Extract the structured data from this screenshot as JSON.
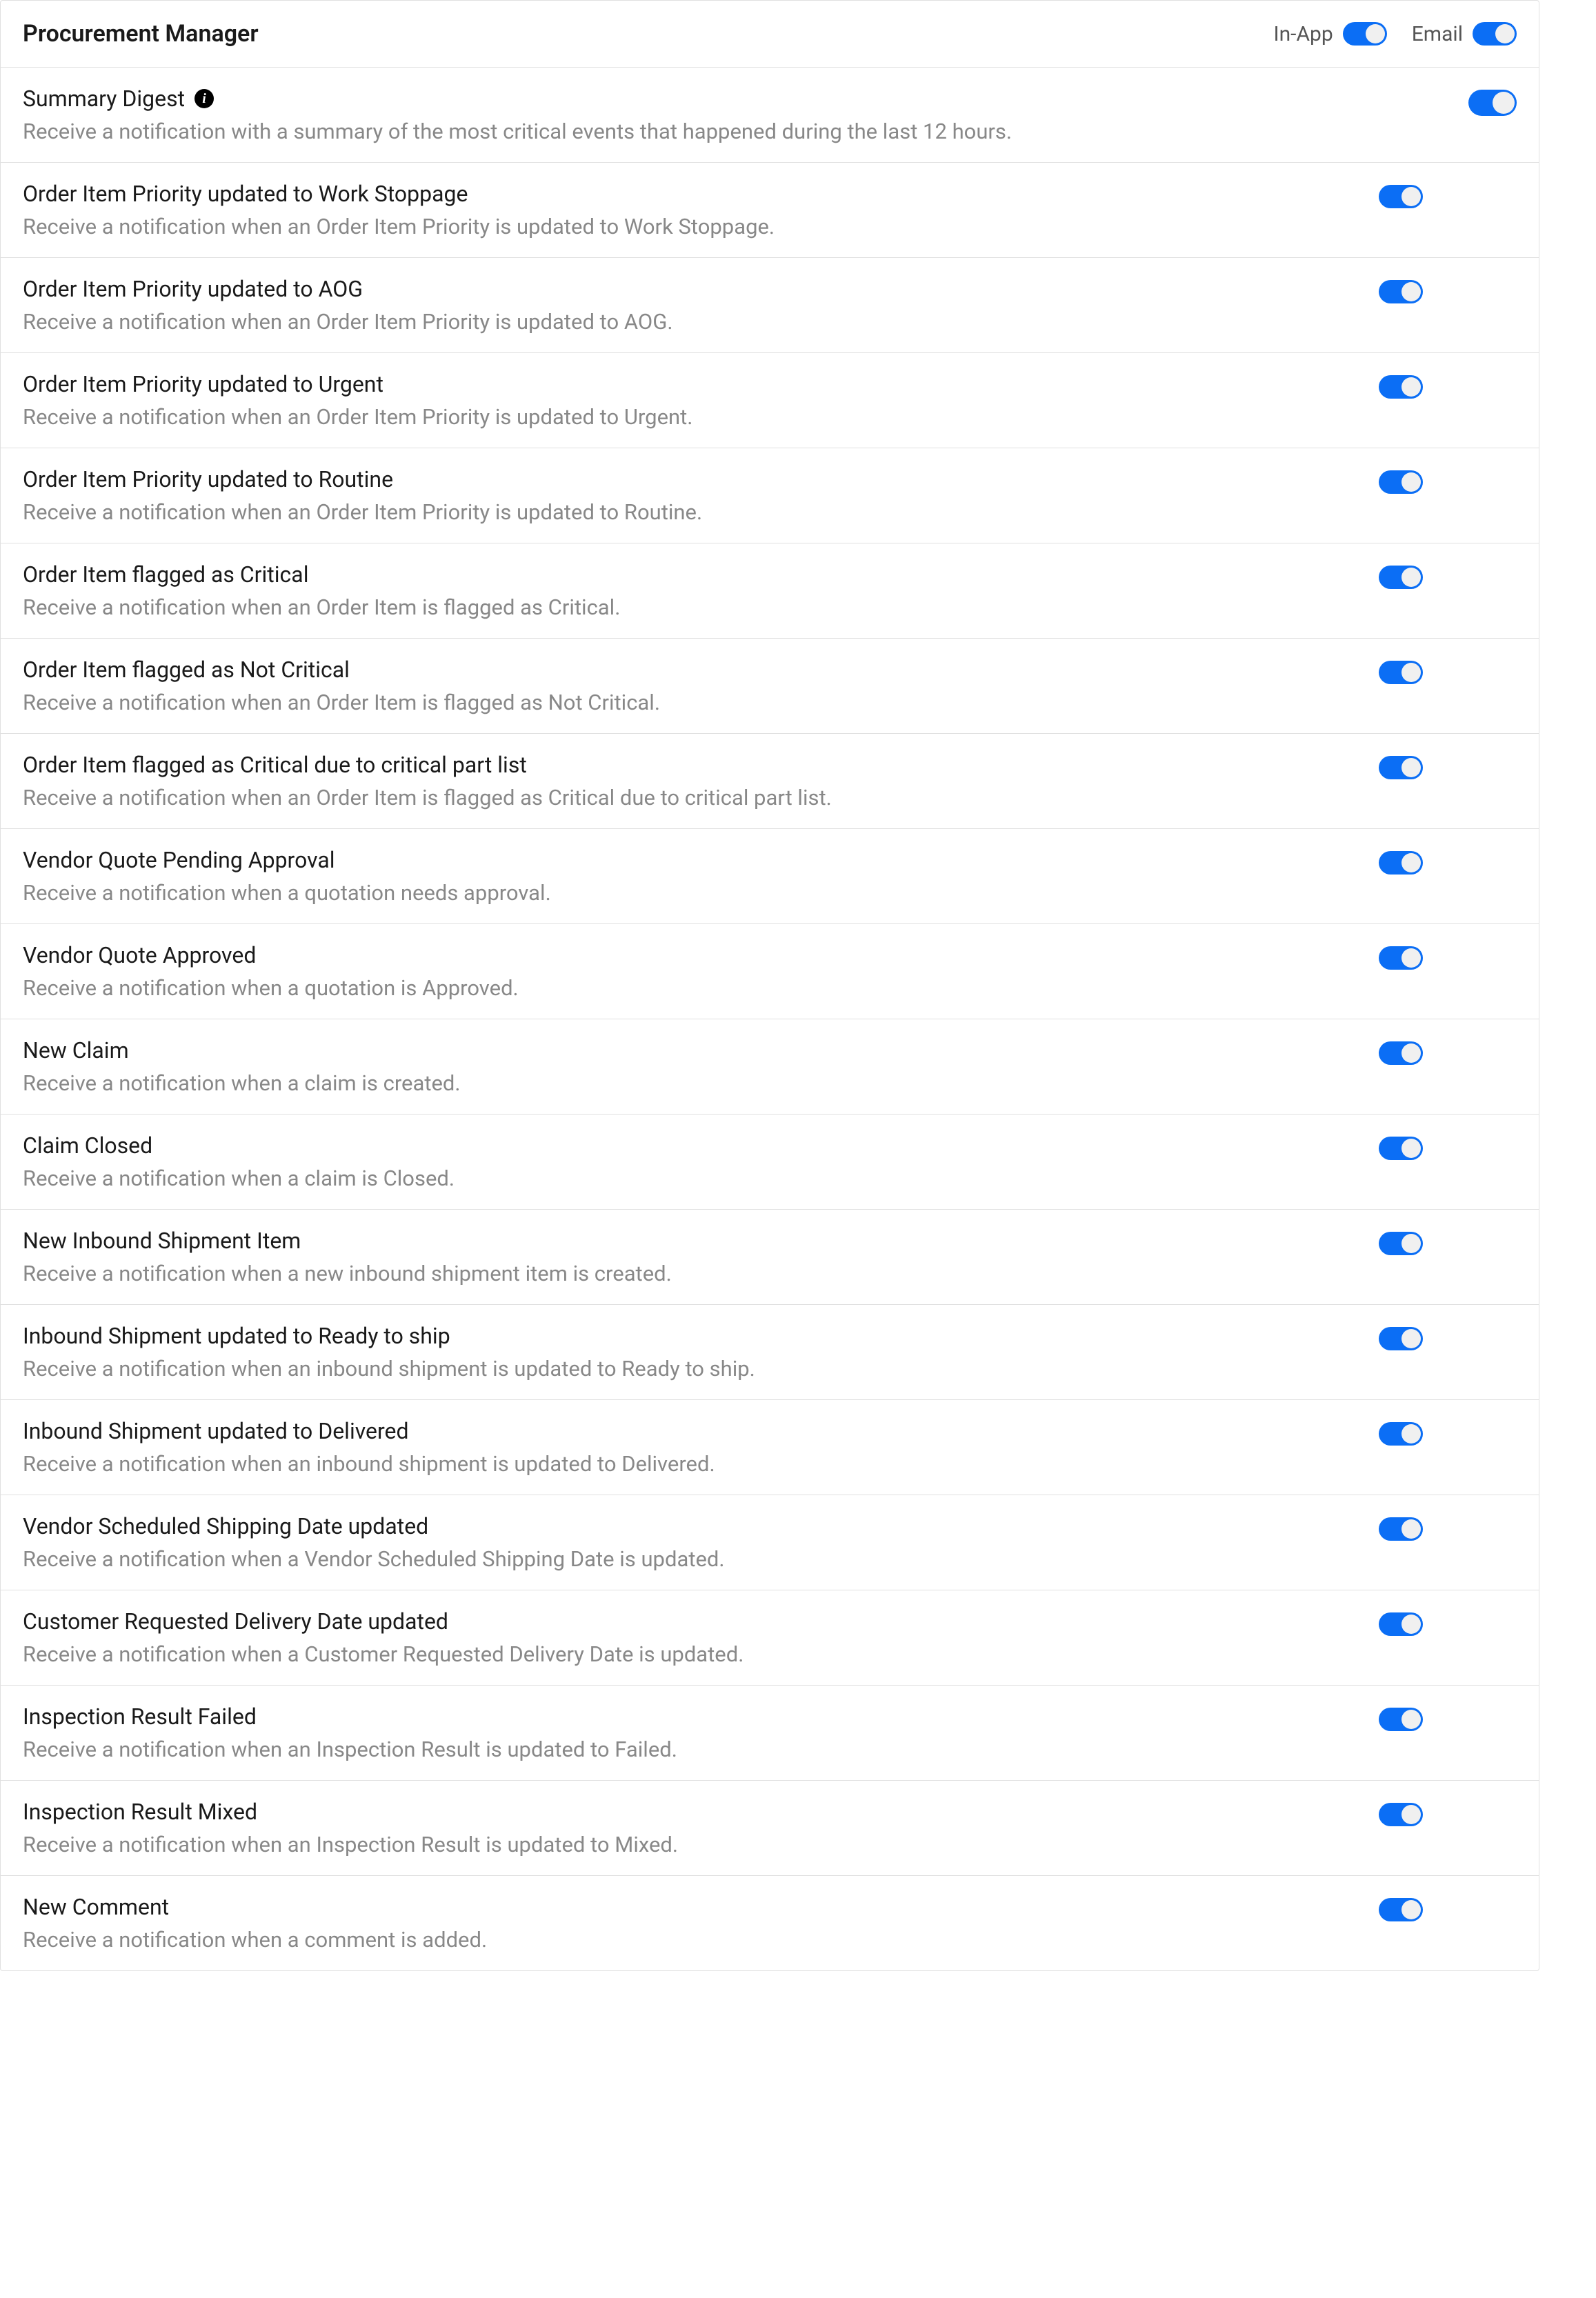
{
  "header": {
    "title": "Procurement Manager",
    "inAppLabel": "In-App",
    "emailLabel": "Email"
  },
  "summaryDigest": {
    "title": "Summary Digest",
    "description": "Receive a notification with a summary of the most critical events that happened during the last 12 hours."
  },
  "notifications": [
    {
      "title": "Order Item Priority updated to Work Stoppage",
      "description": "Receive a notification when an Order Item Priority is updated to Work Stoppage."
    },
    {
      "title": "Order Item Priority updated to AOG",
      "description": "Receive a notification when an Order Item Priority is updated to AOG."
    },
    {
      "title": "Order Item Priority updated to Urgent",
      "description": "Receive a notification when an Order Item Priority is updated to Urgent."
    },
    {
      "title": "Order Item Priority updated to Routine",
      "description": "Receive a notification when an Order Item Priority is updated to Routine."
    },
    {
      "title": "Order Item flagged as Critical",
      "description": "Receive a notification when an Order Item is flagged as Critical."
    },
    {
      "title": "Order Item flagged as Not Critical",
      "description": "Receive a notification when an Order Item is flagged as Not Critical."
    },
    {
      "title": "Order Item flagged as Critical due to critical part list",
      "description": "Receive a notification when an Order Item is flagged as Critical due to critical part list."
    },
    {
      "title": "Vendor Quote Pending Approval",
      "description": "Receive a notification when a quotation needs approval."
    },
    {
      "title": "Vendor Quote Approved",
      "description": "Receive a notification when a quotation is Approved."
    },
    {
      "title": "New Claim",
      "description": "Receive a notification when a claim is created."
    },
    {
      "title": "Claim Closed",
      "description": "Receive a notification when a claim is Closed."
    },
    {
      "title": "New Inbound Shipment Item",
      "description": "Receive a notification when a new inbound shipment item is created."
    },
    {
      "title": "Inbound Shipment updated to Ready to ship",
      "description": "Receive a notification when an inbound shipment is updated to Ready to ship."
    },
    {
      "title": "Inbound Shipment updated to Delivered",
      "description": "Receive a notification when an inbound shipment is updated to Delivered."
    },
    {
      "title": "Vendor Scheduled Shipping Date updated",
      "description": "Receive a notification when a Vendor Scheduled Shipping Date is updated."
    },
    {
      "title": "Customer Requested Delivery Date updated",
      "description": "Receive a notification when a Customer Requested Delivery Date is updated."
    },
    {
      "title": "Inspection Result Failed",
      "description": "Receive a notification when an Inspection Result is updated to Failed."
    },
    {
      "title": "Inspection Result Mixed",
      "description": "Receive a notification when an Inspection Result is updated to Mixed."
    },
    {
      "title": "New Comment",
      "description": "Receive a notification when a comment is added."
    }
  ]
}
